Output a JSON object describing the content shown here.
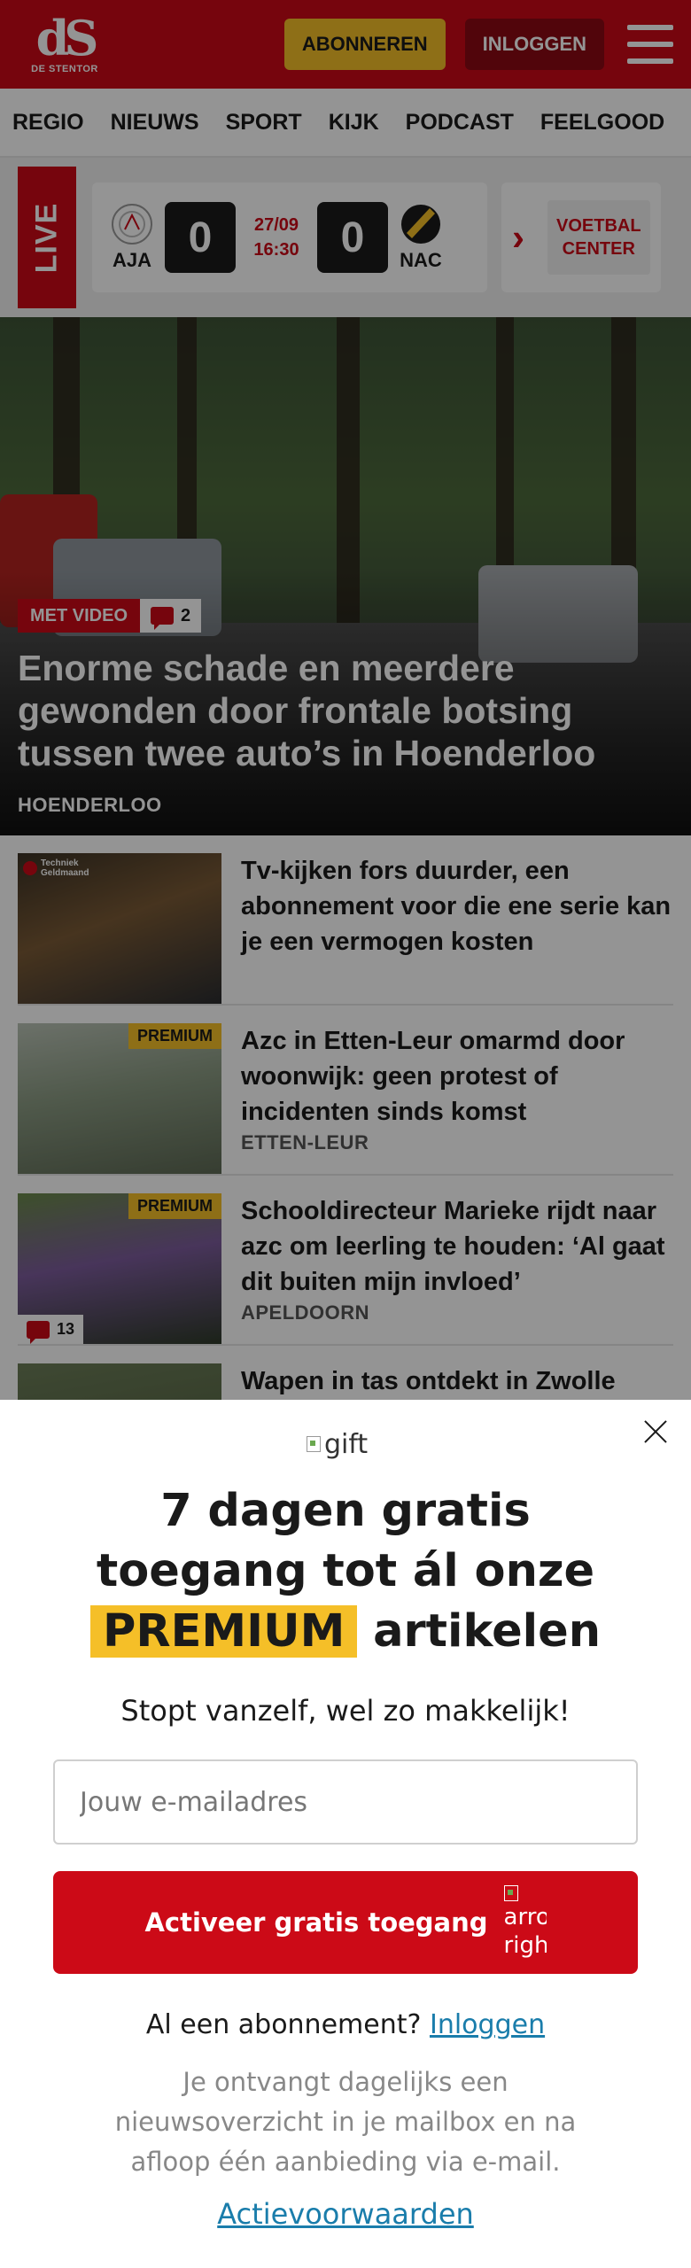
{
  "header": {
    "logo_mark": "dS",
    "logo_name": "DE STENTOR",
    "subscribe_label": "ABONNEREN",
    "login_label": "INLOGGEN"
  },
  "nav": {
    "items": [
      "REGIO",
      "NIEUWS",
      "SPORT",
      "KIJK",
      "PODCAST",
      "FEELGOOD"
    ]
  },
  "live": {
    "tag": "LIVE",
    "home_team": "AJA",
    "home_score": "0",
    "date": "27/09",
    "time": "16:30",
    "away_score": "0",
    "away_team": "NAC",
    "center_line1": "VOETBAL",
    "center_line2": "CENTER"
  },
  "hero": {
    "badge_video": "MET VIDEO",
    "comments": "2",
    "title": "Enorme schade en meerdere gewonden door frontale botsing tussen twee auto’s in Hoenderloo",
    "location": "HOENDERLOO"
  },
  "articles": [
    {
      "title": "Tv-kijken fors duurder, een abonnement voor die ene serie kan je een vermogen kosten",
      "location": "",
      "premium": "",
      "comments": "",
      "brand_line1": "Techniek",
      "brand_line2": "Geldmaand"
    },
    {
      "title": "Azc in Etten-Leur omarmd door woonwijk: geen protest of incidenten sinds komst",
      "location": "ETTEN-LEUR",
      "premium": "PREMIUM",
      "comments": ""
    },
    {
      "title": "Schooldirecteur Marieke rijdt naar azc om leerling te houden: ‘Al gaat dit buiten mijn invloed’",
      "location": "APELDOORN",
      "premium": "PREMIUM",
      "comments": "13"
    },
    {
      "title": "Wapen in tas ontdekt in Zwolle",
      "location": ""
    }
  ],
  "modal": {
    "gift_alt": "gift",
    "headline_line1": "7 dagen gratis",
    "headline_line2": "toegang tot ál onze",
    "headline_premium": "PREMIUM",
    "headline_tail": "artikelen",
    "subtitle": "Stopt vanzelf, wel zo makkelijk!",
    "email_placeholder": "Jouw e-mailadres",
    "cta_label": "Activeer gratis toegang",
    "cta_icon_alt_1": "arro",
    "cta_icon_alt_2": "righ",
    "login_prompt": "Al een abonnement?",
    "login_link": "Inloggen",
    "info": "Je ontvangt dagelijks een nieuwsoverzicht in je mailbox en na afloop één aanbieding via e-mail.",
    "terms": "Actievoorwaarden"
  },
  "colors": {
    "brand_red": "#cc0a17",
    "dark_red": "#8c0a14",
    "premium_yellow": "#f5bf28",
    "link_blue": "#1a7dab"
  },
  "icons": {
    "menu": "hamburger-icon",
    "close": "close-icon",
    "comments": "comment-icon",
    "chevron": "chevron-right-icon"
  }
}
